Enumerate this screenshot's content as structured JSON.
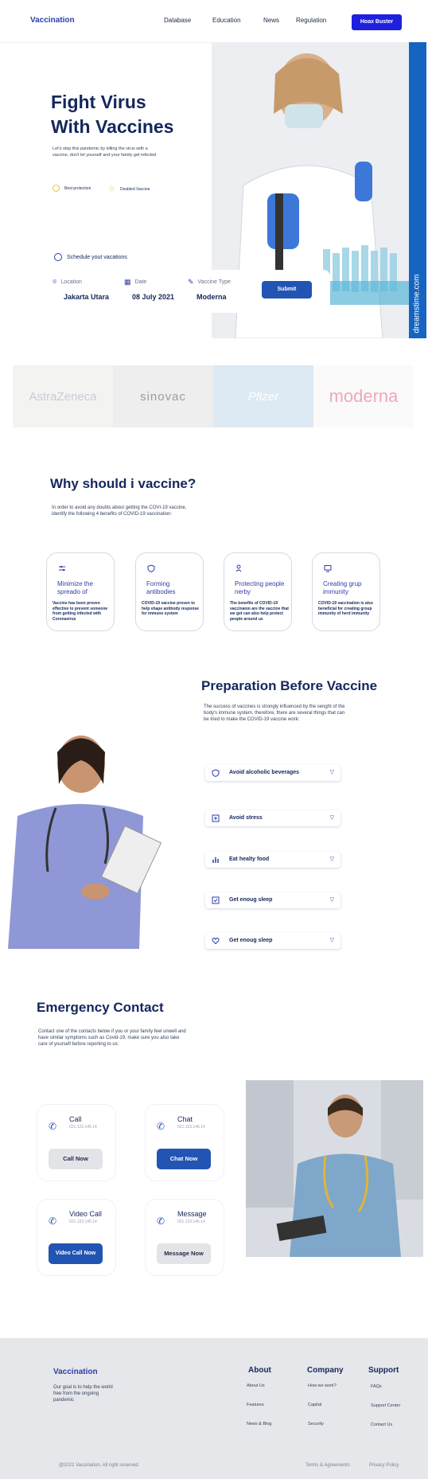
{
  "nav": {
    "brand": "Vaccination",
    "links": [
      "Database",
      "Education",
      "News",
      "Regulation"
    ],
    "cta": "Hoax Buster"
  },
  "hero": {
    "title_line1": "Fight Virus",
    "title_line2": "With Vaccines",
    "subtitle": "Let's stop this pandemic by killing the virus with a vaccine, don't let yourself and your family get infected",
    "features": [
      "Best protection",
      "Doubled Vaccine"
    ],
    "schedule": "Schedule yout vacations",
    "booking": {
      "location_label": "Location",
      "location_value": "Jakarta Utara",
      "date_label": "Date",
      "date_value": "08 July 2021",
      "type_label": "Vaccine Type",
      "type_value": "Moderna",
      "submit": "Submit"
    },
    "watermark": "dreamstime.com"
  },
  "brands": [
    "AstraZeneca",
    "sinovac",
    "Pfizer",
    "moderna"
  ],
  "why": {
    "title": "Why should i vaccine?",
    "description": "In order to avoid any doubts about getting the COVI-19 vaccine, identify the following 4 benefits of COVID-19 vaccination:",
    "cards": [
      {
        "icon": "sliders-icon",
        "title": "Minimize the spreado of",
        "text": "Vaccine has been proven effective to prevent someone from getting infected with Coronavirus"
      },
      {
        "icon": "shield-icon",
        "title": "Forming antibodies",
        "text": "COVID-19 vaccine proven to help shape antibody response for immune system"
      },
      {
        "icon": "users-icon",
        "title": "Protecting people nerby",
        "text": "The benefits of COVID-19 vaccinaion are the vaccine that we get can also help protect people around us"
      },
      {
        "icon": "monitor-icon",
        "title": "Creating grup immunity",
        "text": "COVID-19 vaccination is also beneficial for creating group immunity of herd immunity"
      }
    ]
  },
  "prep": {
    "title": "Preparation Before Vaccine",
    "description": "The success of vaccines is strongly influenced by the senght of the body's immune system. therefore, there are several things that can be tried to make the COVID-19 vaccine work:",
    "items": [
      {
        "icon": "shield-icon",
        "label": "Avoid alcoholic beverages"
      },
      {
        "icon": "plus-square-icon",
        "label": "Avoid stress"
      },
      {
        "icon": "bar-chart-icon",
        "label": "Eat healty food"
      },
      {
        "icon": "check-square-icon",
        "label": "Get enoug sleep"
      },
      {
        "icon": "heart-icon",
        "label": "Get enoug sleep"
      }
    ]
  },
  "emergency": {
    "title": "Emergency Contact",
    "description": "Contact one of the contacts below if you or your family feel unwell and have similar symptoms such as Covid-19, make sure you also take care of yourself before reporting to us:",
    "contacts": [
      {
        "name": "Call",
        "number": "021.123.145.14",
        "button": "Call Now"
      },
      {
        "name": "Chat",
        "number": "021.123.145.14",
        "button": "Chat Now"
      },
      {
        "name": "Video Call",
        "number": "021.123.145.14",
        "button": "Video Call Now"
      },
      {
        "name": "Message",
        "number": "021.123.145.14",
        "button": "Message Now"
      }
    ]
  },
  "footer": {
    "brand": "Vaccination",
    "description": "Our goal is to help the world free from the ongoing pandemic",
    "columns": [
      {
        "title": "About",
        "links": [
          "About Us",
          "Features",
          "News & Blog"
        ]
      },
      {
        "title": "Company",
        "links": [
          "How we work?",
          "Capital",
          "Security"
        ]
      },
      {
        "title": "Support",
        "links": [
          "FAQs",
          "Support Center",
          "Contact Us"
        ]
      }
    ],
    "copyright": "@2021 Vaccination. All right reserved",
    "terms": "Terms & Agreements",
    "privacy": "Privacy Policy"
  },
  "colors": {
    "primary": "#2254b3",
    "navy": "#14275c",
    "accent": "#1f1fe0",
    "star": "#e8c23a"
  }
}
